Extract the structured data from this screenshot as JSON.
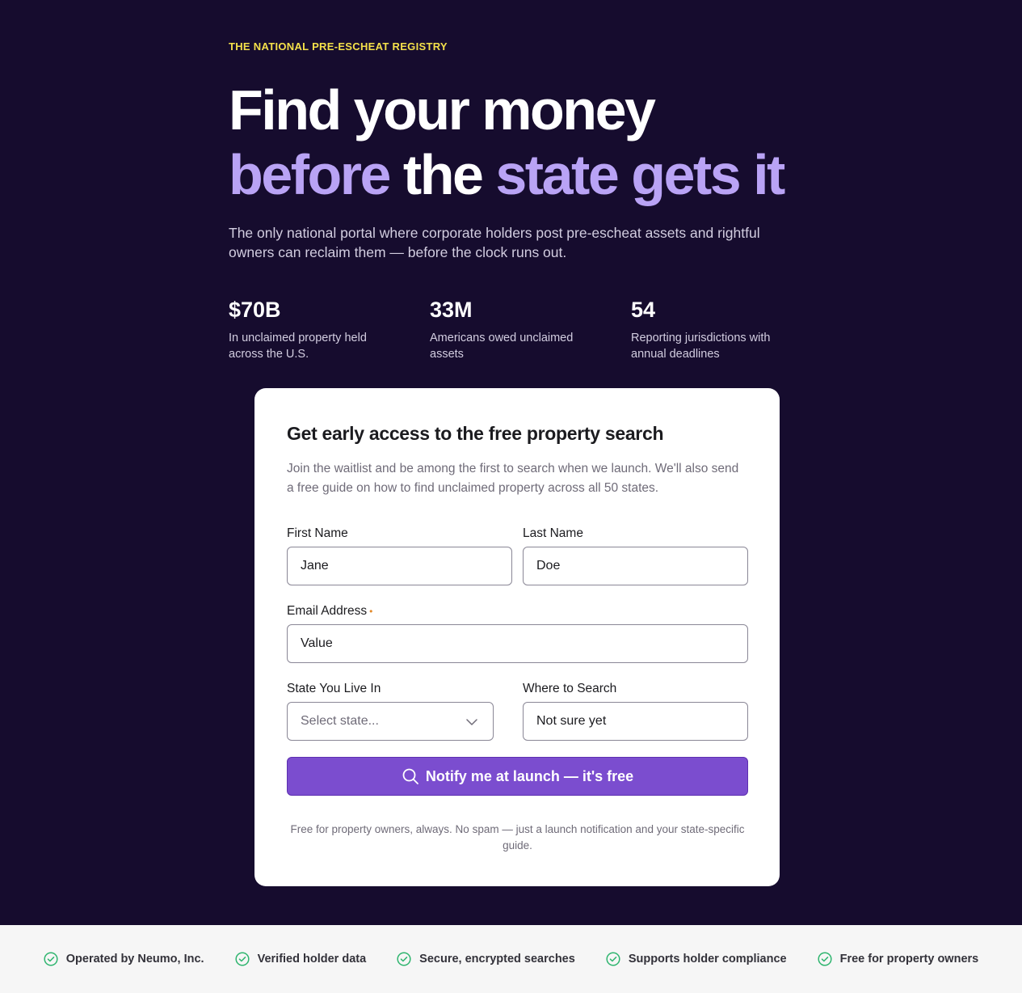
{
  "hero": {
    "eyebrow": "THE NATIONAL PRE-ESCHEAT REGISTRY",
    "headline_line1": "Find your money",
    "headline_line2_part1": "before",
    "headline_line2_part2": "the",
    "headline_line2_part3": "state gets it",
    "subtext": "The only national portal where corporate holders post pre-escheat assets and rightful owners can reclaim them — before the clock runs out.",
    "stats": [
      {
        "value": "$70B",
        "label": "In unclaimed property held across the U.S."
      },
      {
        "value": "33M",
        "label": "Americans owed unclaimed assets"
      },
      {
        "value": "54",
        "label": "Reporting jurisdictions with annual deadlines"
      }
    ]
  },
  "form": {
    "title": "Get early access to the free property search",
    "description": "Join the waitlist and be among the first to search when we launch. We'll also send a free guide on how to find unclaimed property across all 50 states.",
    "first_name_label": "First Name",
    "first_name_value": "Jane",
    "last_name_label": "Last Name",
    "last_name_value": "Doe",
    "email_label": "Email Address",
    "email_required_marker": "•",
    "email_value": "Value",
    "state_label": "State You Live In",
    "state_placeholder": "Select state...",
    "where_label": "Where to Search",
    "where_value": "Not sure yet",
    "submit_label": "Notify me at launch — it's free",
    "fineprint": "Free for property owners, always. No spam — just a launch notification and your state-specific guide."
  },
  "trust": {
    "items": [
      "Operated by Neumo, Inc.",
      "Verified holder data",
      "Secure, encrypted searches",
      "Supports holder compliance",
      "Free for property owners"
    ]
  },
  "colors": {
    "background": "#160c2e",
    "eyebrow": "#f4e04a",
    "accent": "#b9a3f5",
    "button": "#7b4dcf",
    "check": "#2fb56f"
  },
  "icons": {
    "submit": "search-icon",
    "select": "chevron-down-icon",
    "trust": "check-circle-icon"
  }
}
